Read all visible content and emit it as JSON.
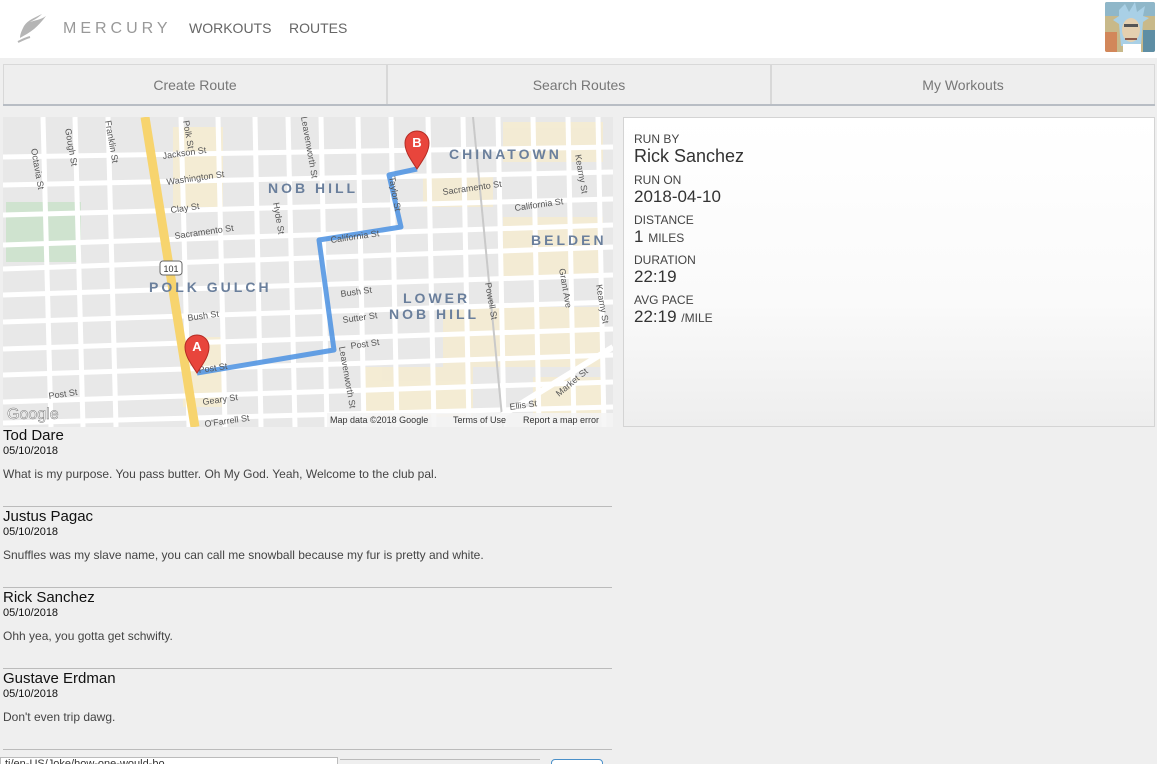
{
  "header": {
    "brand": "MERCURY",
    "nav": [
      "WORKOUTS",
      "ROUTES"
    ]
  },
  "tabs": [
    "Create Route",
    "Search Routes",
    "My Workouts"
  ],
  "map": {
    "labels": {
      "districts": [
        "NOB HILL",
        "CHINATOWN",
        "POLK GULCH",
        "LOWER",
        "NOB HILL",
        "BELDEN"
      ],
      "streets": [
        "Octavia St",
        "Gough St",
        "Franklin St",
        "Polk St",
        "Jackson St",
        "Washington St",
        "Clay St",
        "Sacramento St",
        "Hyde St",
        "Leavenworth St",
        "California St",
        "Taylor St",
        "Sacramento St",
        "California St",
        "Kearny St",
        "Bush St",
        "Bush St",
        "Sutter St",
        "Powell St",
        "Grant Ave",
        "Kearny St",
        "Post St",
        "Post St",
        "Post St",
        "Geary St",
        "Leavenworth St",
        "O'Farrell St",
        "Ellis St",
        "Market St"
      ],
      "highway": "101"
    },
    "marker_a": "A",
    "marker_b": "B",
    "attribution": [
      "Map data ©2018 Google",
      "Terms of Use",
      "Report a map error"
    ],
    "google": "Google"
  },
  "workout": {
    "run_by_label": "RUN BY",
    "run_by": "Rick Sanchez",
    "run_on_label": "RUN ON",
    "run_on": "2018-04-10",
    "distance_label": "DISTANCE",
    "distance": "1",
    "distance_unit": "MILES",
    "duration_label": "DURATION",
    "duration": "22:19",
    "pace_label": "AVG PACE",
    "pace": "22:19",
    "pace_unit": "/MILE"
  },
  "comments": [
    {
      "author": "Tod Dare",
      "date": "05/10/2018",
      "body": "What is my purpose. You pass butter. Oh My God. Yeah, Welcome to the club pal."
    },
    {
      "author": "Justus Pagac",
      "date": "05/10/2018",
      "body": "Snuffles was my slave name, you can call me snowball because my fur is pretty and white."
    },
    {
      "author": "Rick Sanchez",
      "date": "05/10/2018",
      "body": "Ohh yea, you gotta get schwifty."
    },
    {
      "author": "Gustave Erdman",
      "date": "05/10/2018",
      "body": "Don't even trip dawg."
    }
  ],
  "comment_input": {
    "value": "ti/en-US/Joke/how-one-would-bo..."
  },
  "colors": {
    "route": "#4a90e2",
    "marker": "#e8453c",
    "highway": "#f7d46e"
  }
}
